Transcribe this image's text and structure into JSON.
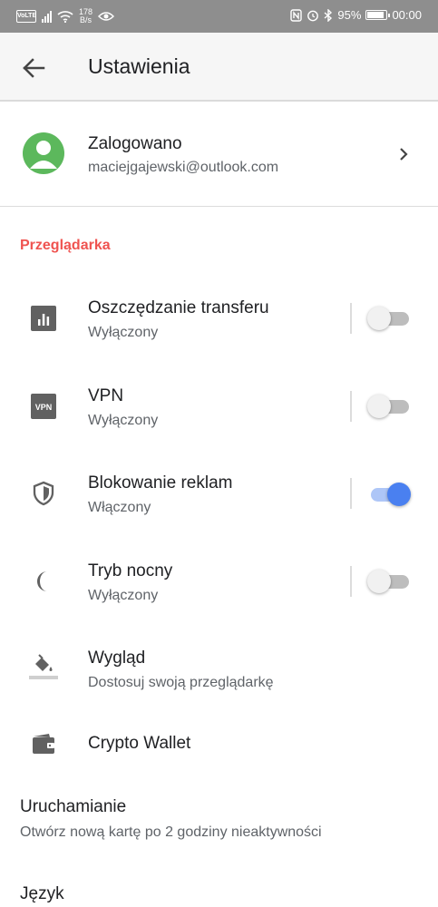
{
  "status_bar": {
    "volte": "VoLTE",
    "speed_value": "178",
    "speed_unit": "B/s",
    "battery": "95%",
    "time": "00:00"
  },
  "header": {
    "title": "Ustawienia"
  },
  "account": {
    "status": "Zalogowano",
    "email": "maciejgajewski@outlook.com"
  },
  "section_browser": "Przeglądarka",
  "settings": [
    {
      "label": "Oszczędzanie transferu",
      "sublabel": "Wyłączony",
      "icon": "bar-chart-icon",
      "enabled": false
    },
    {
      "label": "VPN",
      "sublabel": "Wyłączony",
      "icon_text": "VPN",
      "icon": "vpn-icon",
      "enabled": false
    },
    {
      "label": "Blokowanie reklam",
      "sublabel": "Włączony",
      "icon": "shield-icon",
      "enabled": true
    },
    {
      "label": "Tryb nocny",
      "sublabel": "Wyłączony",
      "icon": "moon-icon",
      "enabled": false
    },
    {
      "label": "Wygląd",
      "sublabel": "Dostosuj swoją przeglądarkę",
      "icon": "paint-bucket-icon"
    },
    {
      "label": "Crypto Wallet",
      "icon": "wallet-icon"
    }
  ],
  "startup": {
    "label": "Uruchamianie",
    "sublabel": "Otwórz nową kartę po 2 godziny nieaktywności"
  },
  "language": {
    "label": "Język"
  },
  "colors": {
    "accent": "#4a80f0",
    "section_header": "#ef5350",
    "avatar": "#5cb85c",
    "status_bar": "#8e8e8e"
  }
}
